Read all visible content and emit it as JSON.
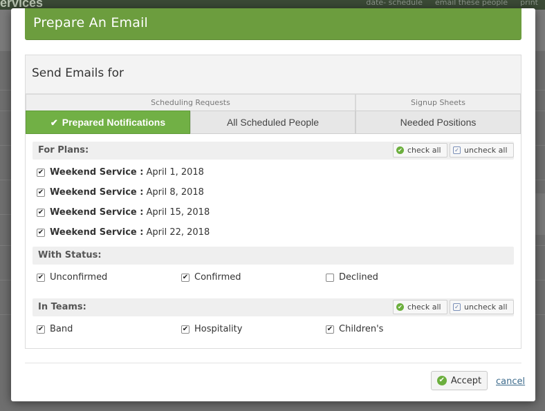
{
  "background": {
    "title": "ervices",
    "links": [
      "date- schedule",
      "email these people",
      "print"
    ]
  },
  "modal": {
    "title": "Prepare An Email",
    "panel_title": "Send Emails for",
    "group_tabs": [
      "Scheduling Requests",
      "Signup Sheets"
    ],
    "tabs": [
      {
        "label": "Prepared Notifications",
        "active": true
      },
      {
        "label": "All Scheduled People",
        "active": false
      },
      {
        "label": "Needed Positions",
        "active": false
      }
    ],
    "check_all": "check all",
    "uncheck_all": "uncheck all",
    "plans": {
      "label": "For Plans:",
      "items": [
        {
          "name": "Weekend Service :",
          "date": "April 1, 2018",
          "checked": true
        },
        {
          "name": "Weekend Service :",
          "date": "April 8, 2018",
          "checked": true
        },
        {
          "name": "Weekend Service :",
          "date": "April 15, 2018",
          "checked": true
        },
        {
          "name": "Weekend Service :",
          "date": "April 22, 2018",
          "checked": true
        }
      ]
    },
    "status": {
      "label": "With Status:",
      "items": [
        {
          "label": "Unconfirmed",
          "checked": true
        },
        {
          "label": "Confirmed",
          "checked": true
        },
        {
          "label": "Declined",
          "checked": false
        }
      ]
    },
    "teams": {
      "label": "In Teams:",
      "items": [
        {
          "label": "Band",
          "checked": true
        },
        {
          "label": "Hospitality",
          "checked": true
        },
        {
          "label": "Children's",
          "checked": true
        }
      ]
    },
    "accept_label": "Accept",
    "cancel_label": "cancel"
  },
  "colors": {
    "header_green": "#6c9d3e",
    "active_tab_green": "#71b045",
    "link_blue": "#3d6b8c"
  }
}
